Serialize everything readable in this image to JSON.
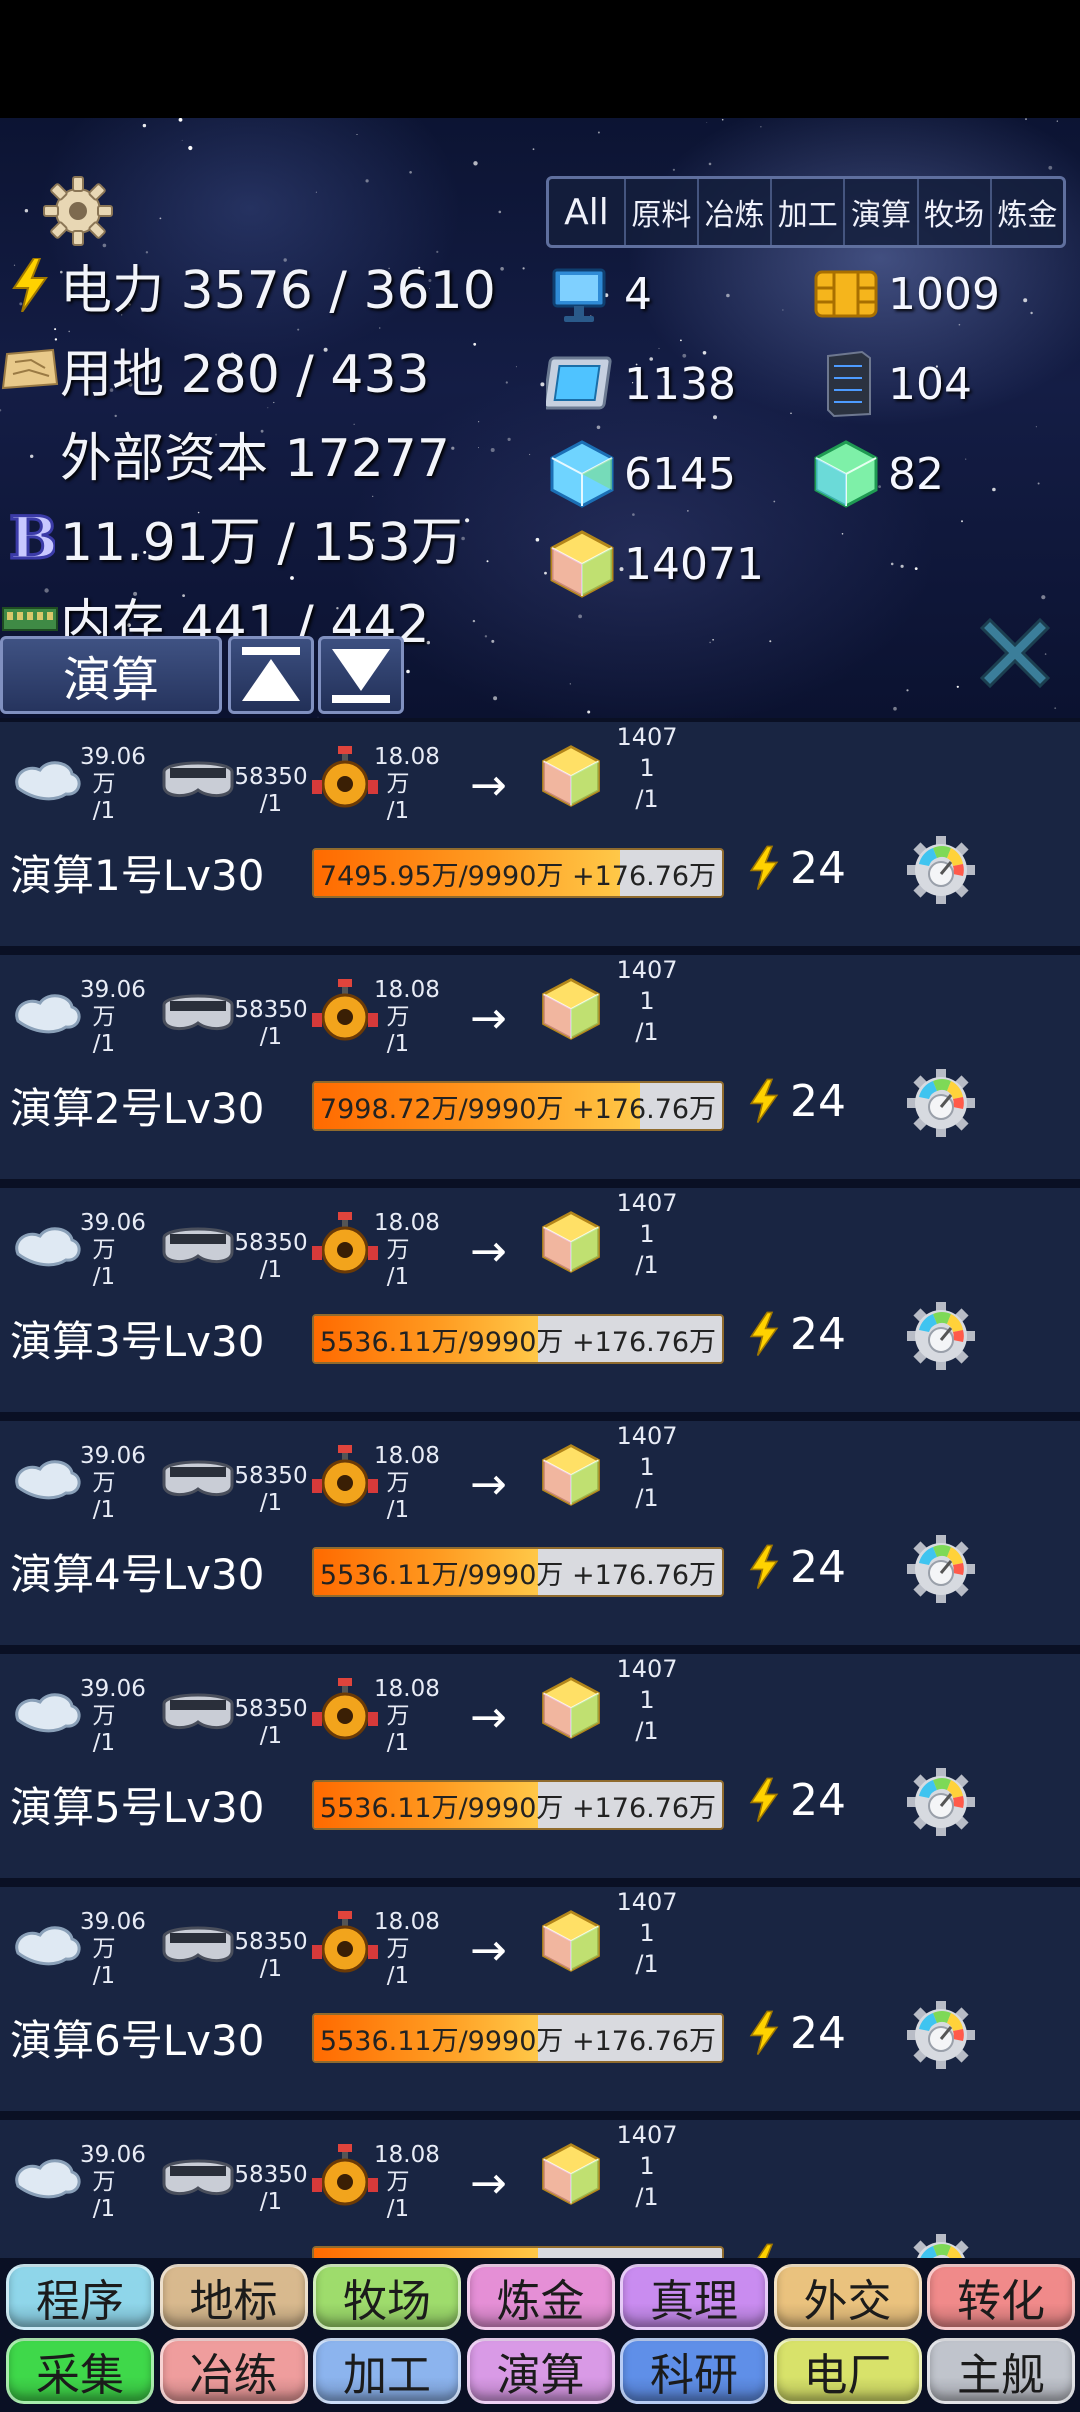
{
  "header": {
    "stats": [
      {
        "icon": "lightning-icon",
        "text": "电力 3576 / 3610"
      },
      {
        "icon": "land-map-icon",
        "text": "用地 280 / 433"
      },
      {
        "icon": "",
        "text": "外部资本 17277"
      },
      {
        "icon": "b-coin-icon",
        "text": "11.91万 / 153万"
      },
      {
        "icon": "memory-chip-icon",
        "text": "内存 441 / 442"
      }
    ],
    "filter_tabs": [
      "All",
      "原料",
      "冶炼",
      "加工",
      "演算",
      "牧场",
      "炼金"
    ],
    "resources": [
      {
        "icon": "computer-icon",
        "value": "4"
      },
      {
        "icon": "sim-chip-icon",
        "value": "1009"
      },
      {
        "icon": "cpu-chip-icon",
        "value": "1138"
      },
      {
        "icon": "server-rack-icon",
        "value": "104"
      },
      {
        "icon": "blue-crystal-cube-icon",
        "value": "6145"
      },
      {
        "icon": "green-crystal-cube-icon",
        "value": "82"
      },
      {
        "icon": "gold-crystal-cube-icon",
        "value": "14071"
      }
    ],
    "current_filter": "演算"
  },
  "rows": [
    {
      "name": "演算1号Lv30",
      "in1": "39.06\n万\n/1",
      "in2": "58350\n/1",
      "in3": "18.08\n万\n/1",
      "out": "1407\n1\n/1",
      "progress_text": "7495.95万/9990万 +176.76万",
      "progress": 0.75,
      "power": "24"
    },
    {
      "name": "演算2号Lv30",
      "in1": "39.06\n万\n/1",
      "in2": "58350\n/1",
      "in3": "18.08\n万\n/1",
      "out": "1407\n1\n/1",
      "progress_text": "7998.72万/9990万 +176.76万",
      "progress": 0.8,
      "power": "24"
    },
    {
      "name": "演算3号Lv30",
      "in1": "39.06\n万\n/1",
      "in2": "58350\n/1",
      "in3": "18.08\n万\n/1",
      "out": "1407\n1\n/1",
      "progress_text": "5536.11万/9990万 +176.76万",
      "progress": 0.55,
      "power": "24"
    },
    {
      "name": "演算4号Lv30",
      "in1": "39.06\n万\n/1",
      "in2": "58350\n/1",
      "in3": "18.08\n万\n/1",
      "out": "1407\n1\n/1",
      "progress_text": "5536.11万/9990万 +176.76万",
      "progress": 0.55,
      "power": "24"
    },
    {
      "name": "演算5号Lv30",
      "in1": "39.06\n万\n/1",
      "in2": "58350\n/1",
      "in3": "18.08\n万\n/1",
      "out": "1407\n1\n/1",
      "progress_text": "5536.11万/9990万 +176.76万",
      "progress": 0.55,
      "power": "24"
    },
    {
      "name": "演算6号Lv30",
      "in1": "39.06\n万\n/1",
      "in2": "58350\n/1",
      "in3": "18.08\n万\n/1",
      "out": "1407\n1\n/1",
      "progress_text": "5536.11万/9990万 +176.76万",
      "progress": 0.55,
      "power": "24"
    },
    {
      "name": "",
      "in1": "39.06\n万\n/1",
      "in2": "58350\n/1",
      "in3": "18.08\n万\n/1",
      "out": "1407\n1\n/1",
      "progress_text": "",
      "progress": 0.55,
      "power": ""
    }
  ],
  "nav": {
    "row1": [
      {
        "label": "程序",
        "color": "#8fd6ea"
      },
      {
        "label": "地标",
        "color": "#d8b98e"
      },
      {
        "label": "牧场",
        "color": "#9edc6c"
      },
      {
        "label": "炼金",
        "color": "#e58fd6"
      },
      {
        "label": "真理",
        "color": "#c98cf0"
      },
      {
        "label": "外交",
        "color": "#eac27e"
      },
      {
        "label": "转化",
        "color": "#f08a8a"
      }
    ],
    "row2": [
      {
        "label": "采集",
        "color": "#3fd84a"
      },
      {
        "label": "冶练",
        "color": "#ef9d9d"
      },
      {
        "label": "加工",
        "color": "#8cb4ee"
      },
      {
        "label": "演算",
        "color": "#d99ae6"
      },
      {
        "label": "科研",
        "color": "#5f8fe8"
      },
      {
        "label": "电厂",
        "color": "#d8e26a"
      },
      {
        "label": "主舰",
        "color": "#c0c4cc"
      }
    ]
  }
}
